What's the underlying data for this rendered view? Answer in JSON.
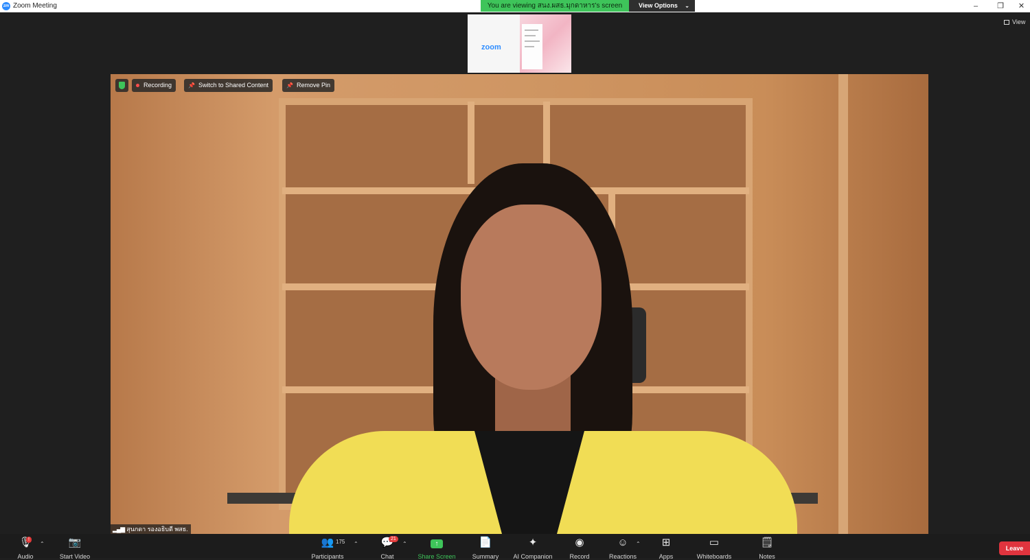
{
  "window": {
    "title": "Zoom Meeting",
    "app_icon": "zm",
    "controls": [
      "–",
      "❐",
      "✕"
    ]
  },
  "banner": {
    "viewing_text": "You are viewing สนง.ผสธ.มุกดาหาร's screen",
    "options_label": "View Options"
  },
  "view_label": "View",
  "thumbnail": {
    "logo_text": "zoom"
  },
  "video": {
    "recording_label": "Recording",
    "switch_label": "Switch to Shared Content",
    "remove_pin_label": "Remove Pin",
    "participant_name": "สุนกดา รองอธิบดี พสธ."
  },
  "toolbar": {
    "audio": {
      "label": "Audio",
      "badge": "!"
    },
    "start_video": {
      "label": "Start Video"
    },
    "participants": {
      "label": "Participants",
      "count": "175"
    },
    "chat": {
      "label": "Chat",
      "badge": "21"
    },
    "share_screen": {
      "label": "Share Screen"
    },
    "summary": {
      "label": "Summary"
    },
    "ai_companion": {
      "label": "AI Companion"
    },
    "record": {
      "label": "Record"
    },
    "reactions": {
      "label": "Reactions"
    },
    "apps": {
      "label": "Apps"
    },
    "whiteboards": {
      "label": "Whiteboards"
    },
    "notes": {
      "label": "Notes"
    },
    "leave": {
      "label": "Leave"
    }
  },
  "colors": {
    "accent_green": "#3ec45a",
    "leave_red": "#e0343e",
    "zoom_blue": "#2d8cff"
  }
}
